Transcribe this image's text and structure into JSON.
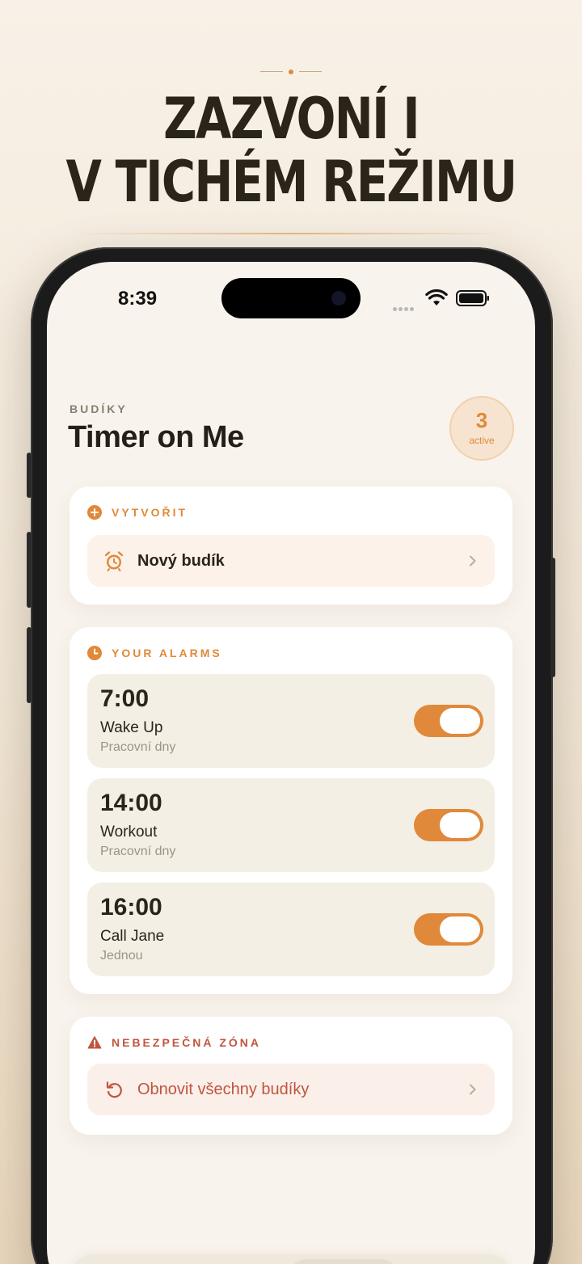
{
  "headline": {
    "line1": "ZAZVONÍ I",
    "line2": "V TICHÉM REŽIMU"
  },
  "status_bar": {
    "time": "8:39"
  },
  "header": {
    "eyebrow": "BUDÍKY",
    "title": "Timer on Me",
    "badge_count": "3",
    "badge_label": "active"
  },
  "create_section": {
    "heading": "VYTVOŘIT",
    "new_alarm_label": "Nový budík"
  },
  "alarms_section": {
    "heading": "YOUR ALARMS",
    "alarms": [
      {
        "time": "7:00",
        "name": "Wake Up",
        "repeat": "Pracovní dny",
        "enabled": true
      },
      {
        "time": "14:00",
        "name": "Workout",
        "repeat": "Pracovní dny",
        "enabled": true
      },
      {
        "time": "16:00",
        "name": "Call Jane",
        "repeat": "Jednou",
        "enabled": true
      }
    ]
  },
  "danger_section": {
    "heading": "NEBEZPEČNÁ ZÓNA",
    "reset_label": "Obnovit všechny budíky"
  },
  "tabbar": {
    "items": [
      {
        "icon": "stopwatch-icon",
        "active": false
      },
      {
        "icon": "timer-icon",
        "active": false
      },
      {
        "icon": "alarm-clock-icon",
        "active": true
      },
      {
        "icon": "gear-icon",
        "active": false
      }
    ]
  },
  "colors": {
    "accent": "#e0893a",
    "danger": "#c0553e",
    "background": "#f8f3ec",
    "text": "#2a241c"
  }
}
